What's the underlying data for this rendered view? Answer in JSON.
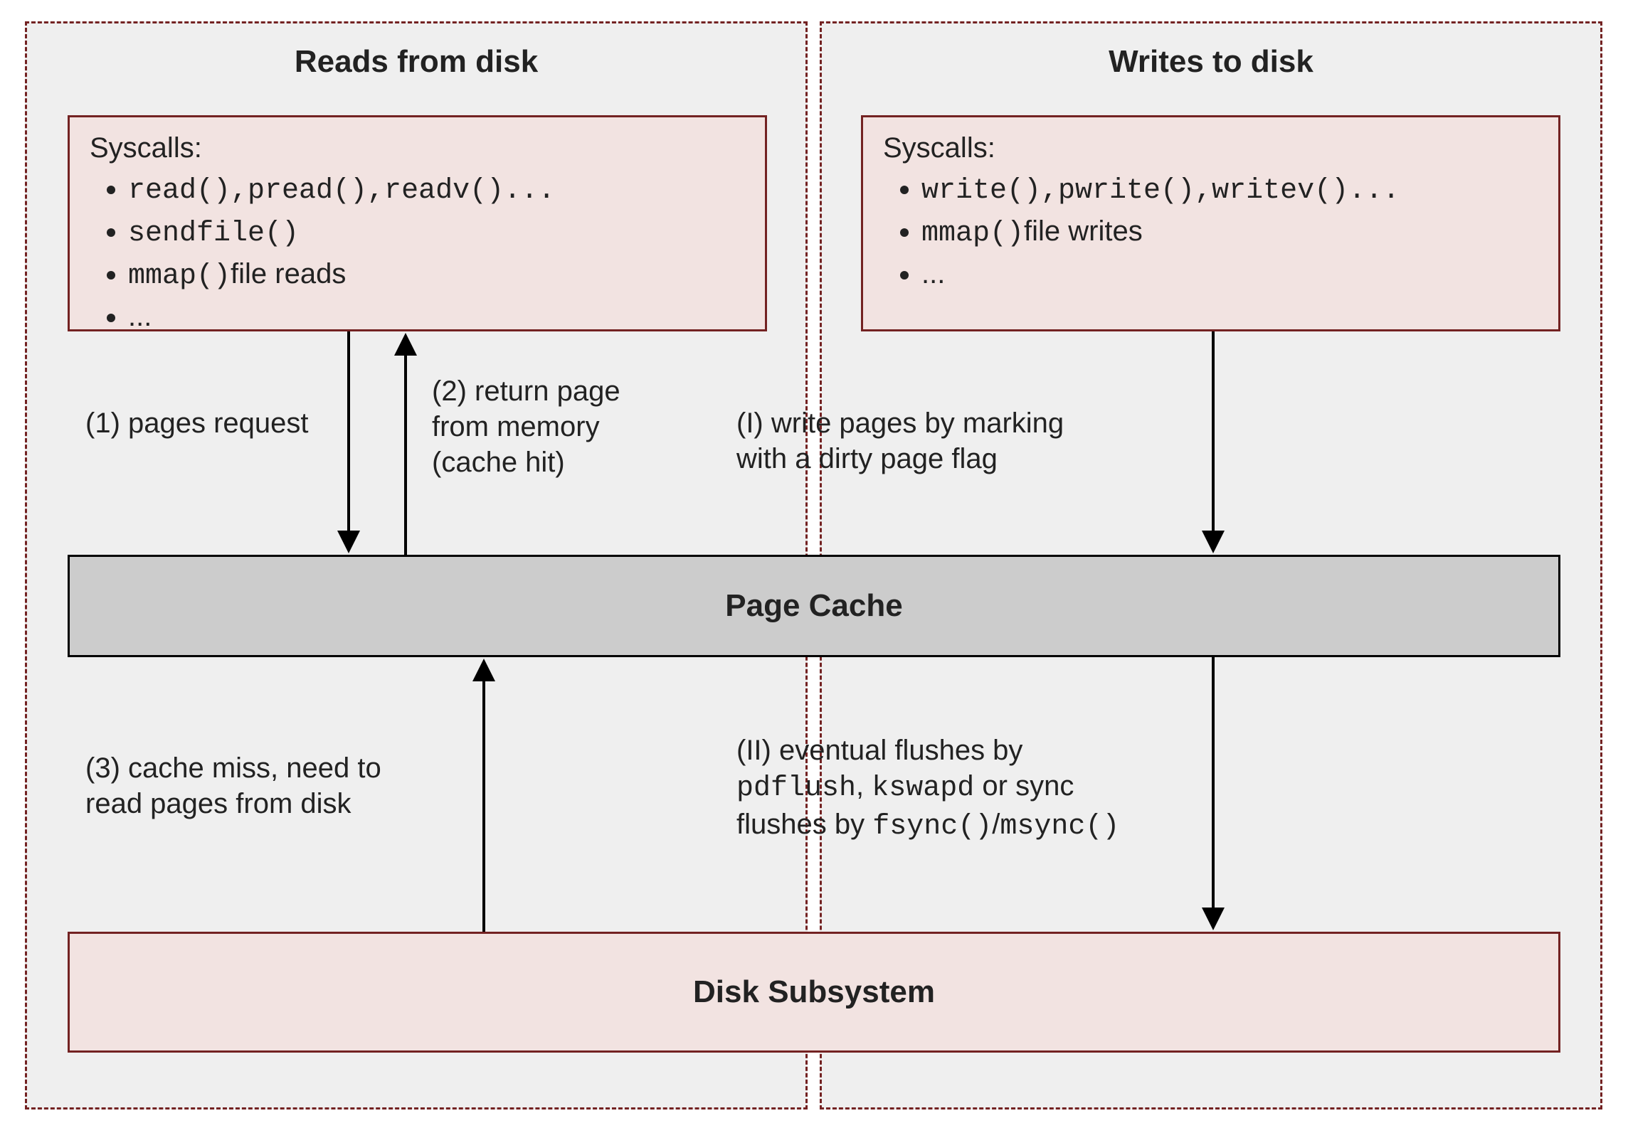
{
  "panels": {
    "reads_title": "Reads from disk",
    "writes_title": "Writes to disk"
  },
  "syscalls_read": {
    "header": "Syscalls:",
    "item1_code": "read(),pread(),readv()...",
    "item2_code": "sendfile()",
    "item3_code": "mmap()",
    "item3_tail": "file reads",
    "item4": "..."
  },
  "syscalls_write": {
    "header": "Syscalls:",
    "item1_code": "write(),pwrite(),writev()...",
    "item2_code": "mmap()",
    "item2_tail": "file writes",
    "item3": "..."
  },
  "arrows": {
    "a1": "(1) pages request",
    "a2_l1": "(2) return page",
    "a2_l2": "from memory",
    "a2_l3": "(cache hit)",
    "a3_l1": "(3) cache miss, need to",
    "a3_l2": "read pages from disk",
    "aI_l1": "(I) write pages by marking",
    "aI_l2": "with a dirty page flag",
    "aII_l1_pre": "(II) eventual flushes by",
    "aII_l2_code1": "pdflush",
    "aII_l2_mid": ", ",
    "aII_l2_code2": "kswapd",
    "aII_l2_tail": " or sync",
    "aII_l3_pre": "flushes by ",
    "aII_l3_code1": "fsync()",
    "aII_l3_slash": "/",
    "aII_l3_code2": "msync()"
  },
  "boxes": {
    "page_cache": "Page Cache",
    "disk_subsystem": "Disk Subsystem"
  }
}
